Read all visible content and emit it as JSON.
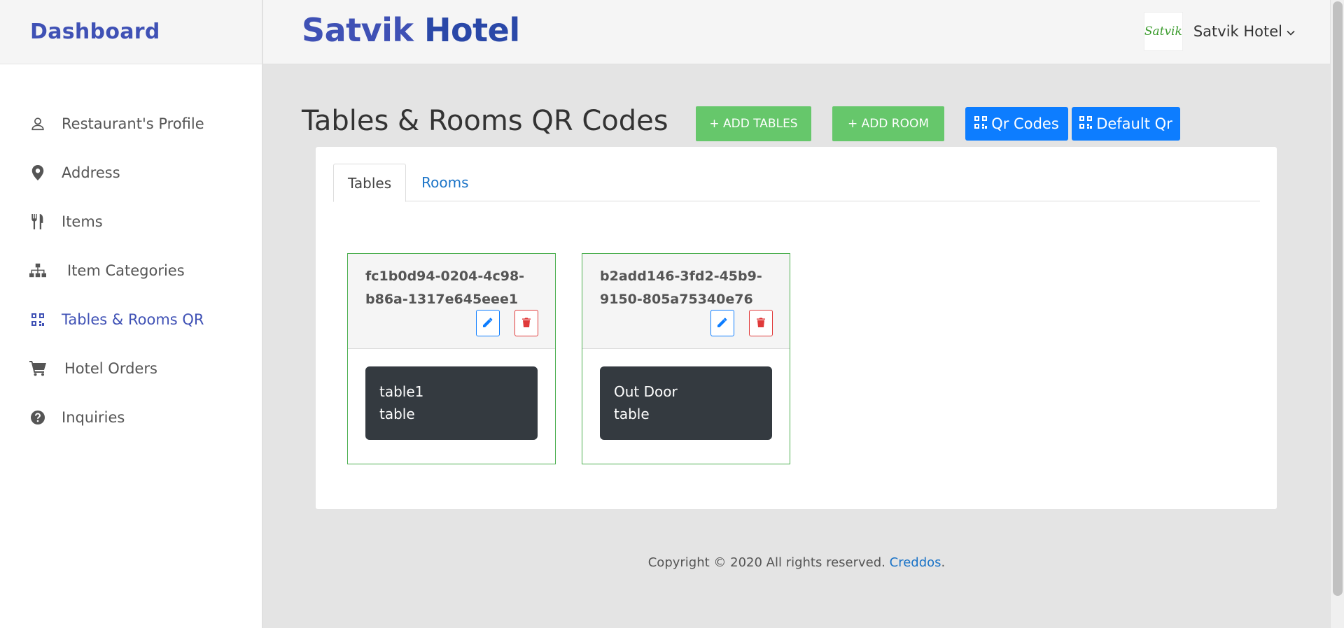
{
  "sidebar": {
    "brand": "Dashboard",
    "items": [
      {
        "label": "Restaurant's Profile",
        "icon": "user-icon"
      },
      {
        "label": "Address",
        "icon": "map-pin-icon"
      },
      {
        "label": "Items",
        "icon": "utensils-icon"
      },
      {
        "label": "Item Categories",
        "icon": "sitemap-icon"
      },
      {
        "label": "Tables & Rooms QR",
        "icon": "qrcode-icon",
        "active": true
      },
      {
        "label": "Hotel Orders",
        "icon": "cart-icon"
      },
      {
        "label": "Inquiries",
        "icon": "question-circle-icon"
      }
    ]
  },
  "header": {
    "title_part1": "Satvik",
    "title_part2": "Hotel",
    "user_name": "Satvik Hotel",
    "avatar_text": "Satvik"
  },
  "main": {
    "page_title": "Tables & Rooms QR Codes",
    "buttons": {
      "add_tables": "+ ADD TABLES",
      "add_room": "+ ADD ROOM",
      "qr_codes": "Qr Codes",
      "default_qr": "Default Qr"
    },
    "tabs": [
      {
        "label": "Tables",
        "active": true
      },
      {
        "label": "Rooms",
        "active": false
      }
    ],
    "qr_cards": [
      {
        "uuid": "fc1b0d94-0204-4c98-b86a-1317e645eee1",
        "name": "table1",
        "type": "table"
      },
      {
        "uuid": "b2add146-3fd2-45b9-9150-805a75340e76",
        "name": "Out Door",
        "type": "table"
      }
    ]
  },
  "footer": {
    "text": "Copyright © 2020 All rights reserved.",
    "link": "Creddos",
    "suffix": "."
  },
  "colors": {
    "brand": "#3f51b5",
    "green_button": "#66c76b",
    "blue_button": "#0d7dff",
    "card_border": "#4caf50",
    "badge_bg": "#343a40",
    "delete_red": "#e03a3a"
  }
}
